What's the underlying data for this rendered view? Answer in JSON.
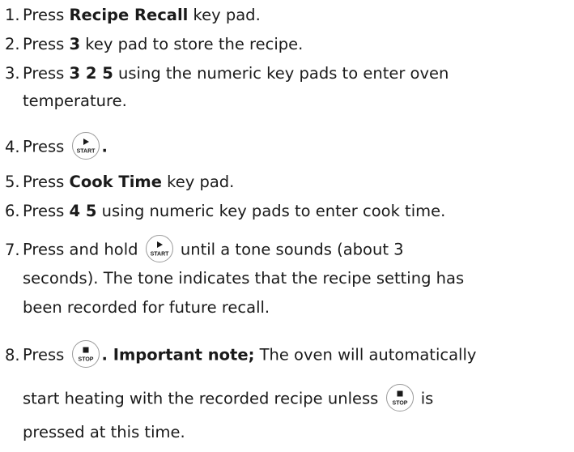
{
  "steps": [
    {
      "num": "1.",
      "pre": "Press ",
      "bold": "Recipe Recall",
      "post": " key pad."
    },
    {
      "num": "2.",
      "pre": "Press ",
      "bold": "3",
      "post": " key pad to store the recipe."
    },
    {
      "num": "3.",
      "pre": "Press ",
      "bold": "3 2 5",
      "post": " using the numeric key pads to enter oven",
      "cont": "temperature."
    },
    {
      "num": "4.",
      "pre": "Press ",
      "post": "."
    },
    {
      "num": "5.",
      "pre": "Press ",
      "bold": "Cook Time",
      "post": " key pad."
    },
    {
      "num": "6.",
      "pre": "Press ",
      "bold": "4 5",
      "post": " using numeric key pads to enter cook time."
    },
    {
      "num": "7.",
      "pre": "Press and hold ",
      "post": " until a tone sounds (about 3",
      "cont": "seconds). The tone indicates that the recipe setting has",
      "cont2": "been recorded for future recall."
    },
    {
      "num": "8.",
      "pre": "Press ",
      "bold": ". Important note;",
      "post": " The oven will automatically",
      "cont_pre": "start heating with the recorded recipe unless ",
      "cont_post": " is",
      "cont2": "pressed at this time."
    }
  ],
  "keys": {
    "start_label": "START",
    "stop_label": "STOP"
  }
}
